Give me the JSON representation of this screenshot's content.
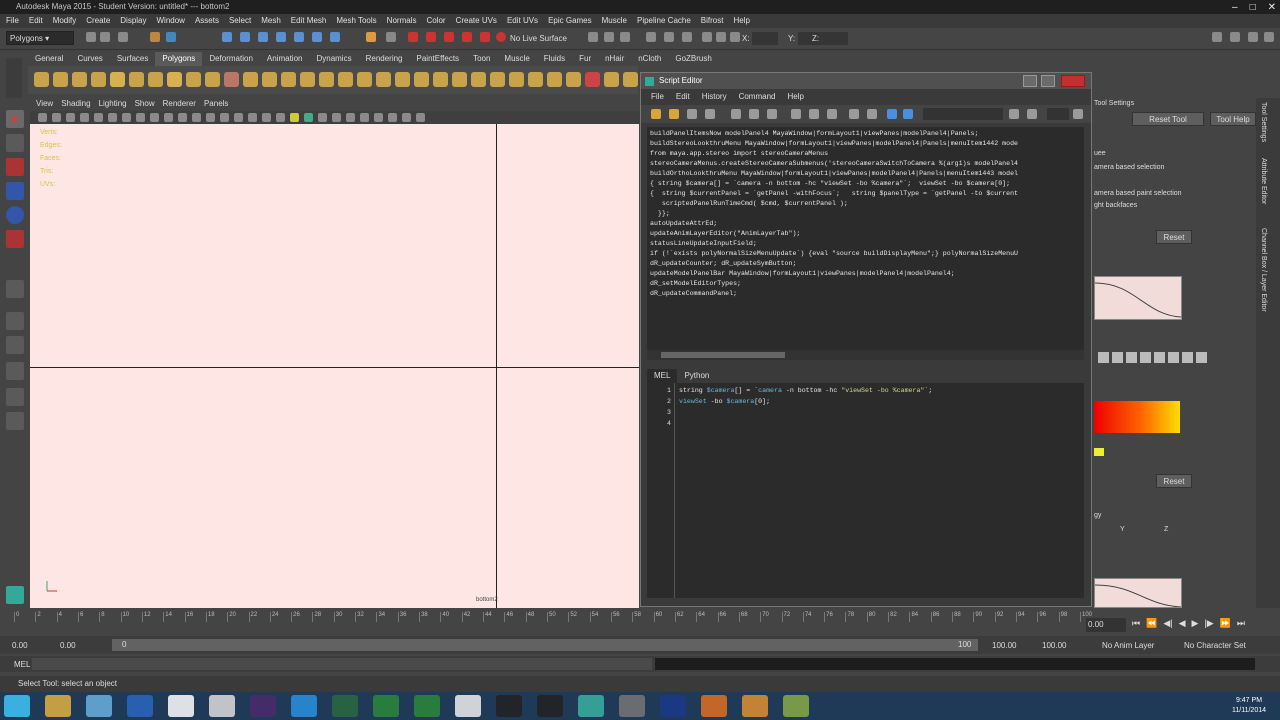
{
  "window_title": "Autodesk Maya 2015 - Student Version: untitled*   ---   bottom2",
  "menubar": [
    "File",
    "Edit",
    "Modify",
    "Create",
    "Display",
    "Window",
    "Assets",
    "Select",
    "Mesh",
    "Edit Mesh",
    "Mesh Tools",
    "Normals",
    "Color",
    "Create UVs",
    "Edit UVs",
    "Epic Games",
    "Muscle",
    "Pipeline Cache",
    "Bifrost",
    "Help"
  ],
  "statusline": {
    "mode": "Polygons",
    "live_surface": "No Live Surface",
    "x_label": "X:",
    "y_label": "Y:",
    "z_label": "Z:"
  },
  "shelf_tabs": [
    "General",
    "Curves",
    "Surfaces",
    "Polygons",
    "Deformation",
    "Animation",
    "Dynamics",
    "Rendering",
    "PaintEffects",
    "Toon",
    "Muscle",
    "Fluids",
    "Fur",
    "nHair",
    "nCloth",
    "GoZBrush"
  ],
  "shelf_active": "Polygons",
  "panel_menu": [
    "View",
    "Shading",
    "Lighting",
    "Show",
    "Renderer",
    "Panels"
  ],
  "hud": [
    "Verts:",
    "Edges:",
    "Faces:",
    "Tris:",
    "UVs:"
  ],
  "camera_label": "bottom2",
  "script_editor": {
    "title": "Script Editor",
    "menu": [
      "File",
      "Edit",
      "History",
      "Command",
      "Help"
    ],
    "history": [
      "buildPanelItemsNow modelPanel4 MayaWindow|formLayout1|viewPanes|modelPanel4|Panels;",
      "buildStereoLookthruMenu MayaWindow|formLayout1|viewPanes|modelPanel4|Panels|menuItem1442 mode",
      "from maya.app.stereo import stereoCameraMenus",
      "stereoCameraMenus.createStereoCameraSubmenus('stereoCameraSwitchToCamera %(arg1)s modelPanel4",
      "buildOrthoLookthruMenu MayaWindow|formLayout1|viewPanes|modelPanel4|Panels|menuItem1443 model",
      "{ string $camera[] = `camera -n bottom -hc \"viewSet -bo %camera\"`;  viewSet -bo $camera[0];",
      "{  string $currentPanel = `getPanel -withFocus`;   string $panelType = `getPanel -to $current",
      "   scriptedPanelRunTimeCmd( $cmd, $currentPanel );",
      "  }};",
      "autoUpdateAttrEd;",
      "updateAnimLayerEditor(\"AnimLayerTab\");",
      "statusLineUpdateInputField;",
      "if (!`exists polyNormalSizeMenuUpdate`) {eval \"source buildDisplayMenu\";} polyNormalSizeMenuU",
      "dR_updateCounter; dR_updateSymButton;",
      "updateModelPanelBar MayaWindow|formLayout1|viewPanes|modelPanel4|modelPanel4;",
      "dR_setModelEditorTypes;",
      "dR_updateCommandPanel;"
    ],
    "tabs": [
      "MEL",
      "Python"
    ],
    "active_tab": "MEL",
    "line_numbers": [
      "1",
      "2",
      "3",
      "4"
    ],
    "line1": {
      "a": "string ",
      "b": "$camera",
      "c": "[] = `",
      "d": "camera",
      "e": " -n bottom -hc ",
      "f": "\"viewSet -bo %camera\"",
      "g": "`;"
    },
    "line2": {
      "a": "viewSet",
      "b": " -bo ",
      "c": "$camera",
      "d": "[0];"
    }
  },
  "attribute_editor": {
    "title": "Tool Settings",
    "reset_tool": "Reset Tool",
    "tool_help": "Tool Help",
    "labels": [
      "uee",
      "amera based selection",
      "amera based paint selection",
      "ght backfaces",
      "Y",
      "Z",
      "gy"
    ],
    "reset": "Reset",
    "side_tabs": [
      "Tool Settings",
      "Attribute Editor",
      "Channel Box / Layer Editor"
    ]
  },
  "timeline": {
    "ticks": [
      "0",
      "2",
      "4",
      "6",
      "8",
      "10",
      "12",
      "14",
      "16",
      "18",
      "20",
      "22",
      "24",
      "26",
      "28",
      "30",
      "32",
      "34",
      "36",
      "38",
      "40",
      "42",
      "44",
      "46",
      "48",
      "50",
      "52",
      "54",
      "56",
      "58",
      "60",
      "62",
      "64",
      "66",
      "68",
      "70",
      "72",
      "74",
      "76",
      "78",
      "80",
      "82",
      "84",
      "86",
      "88",
      "90",
      "92",
      "94",
      "96",
      "98",
      "100"
    ],
    "current": "0.00",
    "range_start": "0.00",
    "range_start2": "0.00",
    "range_handle": "0",
    "range_end_handle": "100",
    "range_end": "100.00",
    "range_end2": "100.00",
    "anim_layer": "No Anim Layer",
    "char_set": "No Character Set"
  },
  "command_line": {
    "label": "MEL"
  },
  "help_line": "Select Tool: select an object",
  "taskbar": {
    "time": "9:47 PM",
    "date": "11/11/2014",
    "apps": [
      "start",
      "explorer",
      "files",
      "chrome",
      "unreal",
      "unity",
      "premiere",
      "skype",
      "audition",
      "camtasia",
      "excel",
      "camera",
      "inkscape",
      "app",
      "maya",
      "search",
      "photoshop",
      "firefox",
      "orange",
      "cube"
    ]
  }
}
